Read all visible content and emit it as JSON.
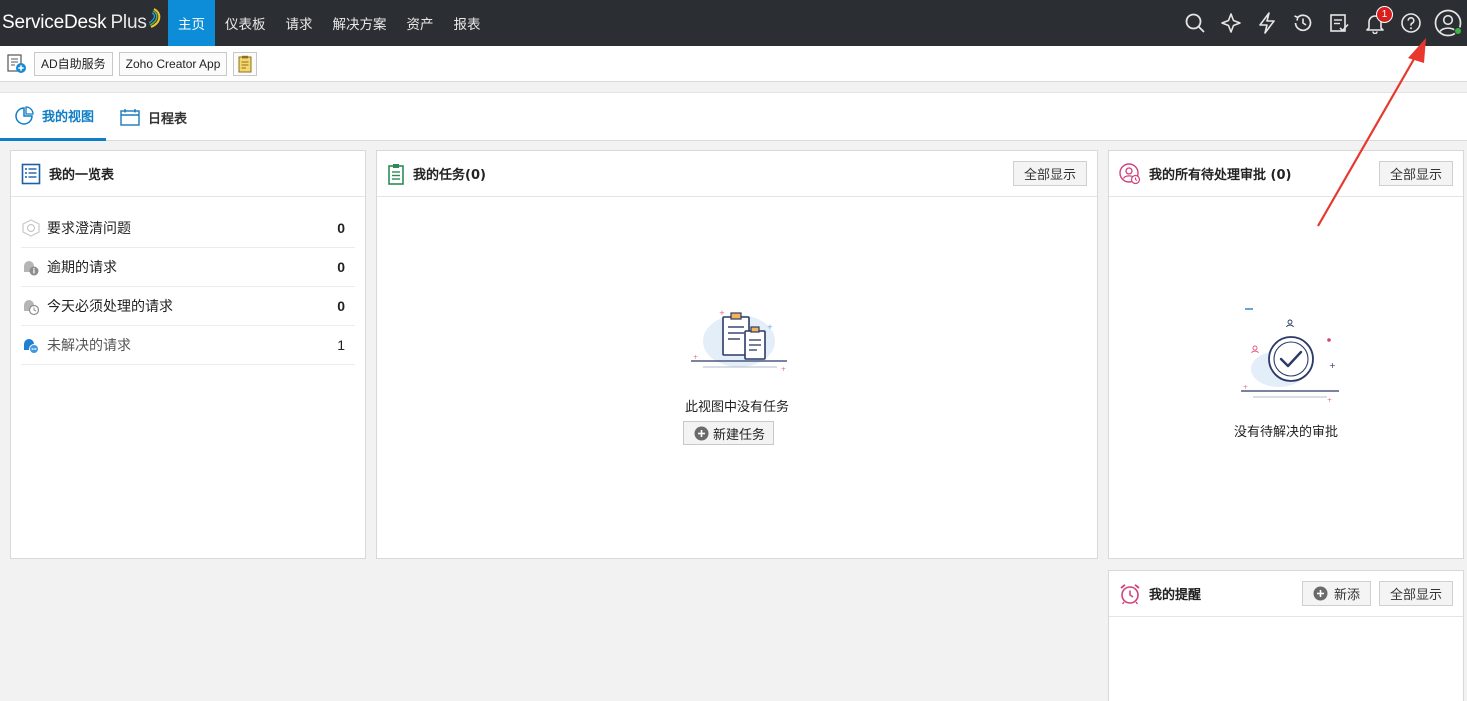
{
  "app": {
    "name": "ServiceDesk",
    "plus": "Plus"
  },
  "nav": [
    {
      "label": "主页",
      "active": true
    },
    {
      "label": "仪表板"
    },
    {
      "label": "请求"
    },
    {
      "label": "解决方案"
    },
    {
      "label": "资产"
    },
    {
      "label": "报表"
    }
  ],
  "notifications": {
    "count": "1"
  },
  "quickbar": {
    "ad_label": "AD自助服务",
    "zoho_label": "Zoho Creator App"
  },
  "tabs": {
    "my_view": "我的视图",
    "schedule": "日程表"
  },
  "summary": {
    "title": "我的一览表",
    "items": [
      {
        "label": "要求澄清问题",
        "count": "0"
      },
      {
        "label": "逾期的请求",
        "count": "0"
      },
      {
        "label": "今天必须处理的请求",
        "count": "0"
      },
      {
        "label": "未解决的请求",
        "count": "1"
      }
    ]
  },
  "tasks": {
    "title": "我的任务(0)",
    "show_all": "全部显示",
    "empty": "此视图中没有任务",
    "new_task": "新建任务"
  },
  "approvals": {
    "title": "我的所有待处理审批 (0)",
    "show_all": "全部显示",
    "empty": "没有待解决的审批"
  },
  "reminders": {
    "title": "我的提醒",
    "add": "新添",
    "show_all": "全部显示"
  },
  "colors": {
    "topbar": "#2b2f33",
    "accent": "#0d8cd8",
    "badge": "#d71f1f",
    "arrow": "#e8382e"
  }
}
